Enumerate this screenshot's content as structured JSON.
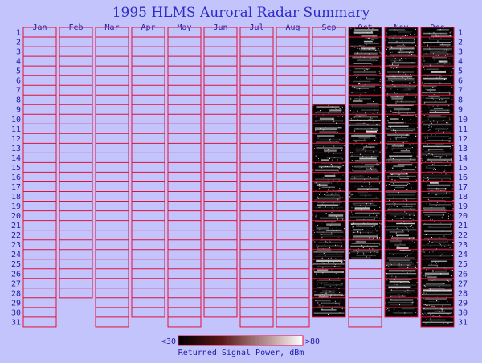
{
  "chart_data": {
    "type": "heatmap",
    "title": "1995 HLMS Auroral Radar Summary",
    "months": [
      "Jan",
      "Feb",
      "Mar",
      "Apr",
      "May",
      "Jun",
      "Jul",
      "Aug",
      "Sep",
      "Oct",
      "Nov",
      "Dec"
    ],
    "days_in_month": [
      31,
      28,
      31,
      30,
      31,
      30,
      31,
      31,
      30,
      31,
      30,
      31
    ],
    "day_labels": [
      "1",
      "2",
      "3",
      "4",
      "5",
      "6",
      "7",
      "8",
      "9",
      "10",
      "11",
      "12",
      "13",
      "14",
      "15",
      "16",
      "17",
      "18",
      "19",
      "20",
      "21",
      "22",
      "23",
      "24",
      "25",
      "26",
      "27",
      "28",
      "29",
      "30",
      "31"
    ],
    "data_coverage": [
      {
        "month": "Sep",
        "first_day": 9,
        "last_day": 30
      },
      {
        "month": "Oct",
        "first_day": 1,
        "last_day": 24
      },
      {
        "month": "Nov",
        "first_day": 1,
        "last_day": 30
      },
      {
        "month": "Dec",
        "first_day": 1,
        "last_day": 31
      }
    ],
    "colorbar": {
      "min_label": "<30",
      "max_label": ">80",
      "label": "Returned Signal Power, dBm"
    },
    "colors": {
      "background": "#c4c4fc",
      "grid": "#e0103a",
      "text": "#1c1ca8",
      "title": "#2d2dc8"
    }
  }
}
